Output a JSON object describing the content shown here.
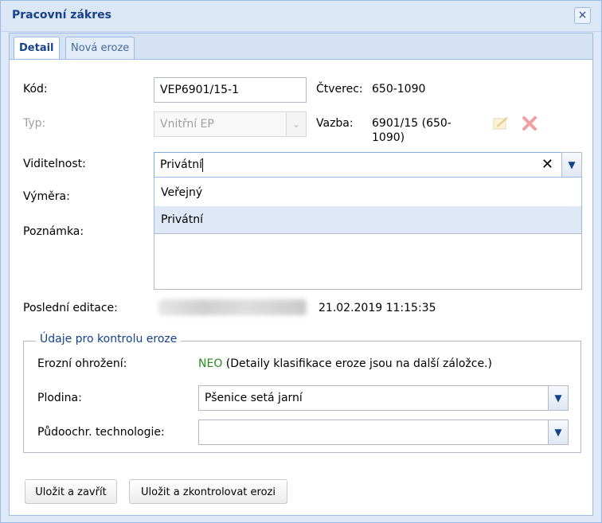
{
  "window": {
    "title": "Pracovní zákres"
  },
  "tabs": [
    {
      "label": "Detail",
      "active": true
    },
    {
      "label": "Nová eroze",
      "active": false
    }
  ],
  "form": {
    "kod": {
      "label": "Kód:",
      "value": "VEP6901/15-1"
    },
    "ctverec": {
      "label": "Čtverec:",
      "value": "650-1090"
    },
    "typ": {
      "label": "Typ:",
      "value": "Vnitřní EP"
    },
    "vazba": {
      "label": "Vazba:",
      "value_line1": "6901/15 (650-",
      "value_line2": "1090)"
    },
    "viditelnost": {
      "label": "Viditelnost:",
      "value": "Privátní",
      "options": [
        "Veřejný",
        "Privátní"
      ]
    },
    "vymera": {
      "label": "Výměra:"
    },
    "poznamka": {
      "label": "Poznámka:"
    },
    "posledni_editace": {
      "label": "Poslední editace:",
      "value": "21.02.2019 11:15:35"
    }
  },
  "eroze": {
    "legend": "Údaje pro kontrolu eroze",
    "ohrozeni_label": "Erozní ohrožení:",
    "ohrozeni_value": "NEO",
    "ohrozeni_note": "(Detaily klasifikace eroze jsou na další záložce.)",
    "plodina_label": "Plodina:",
    "plodina_value": "Pšenice setá jarní",
    "technologie_label": "Půdoochr. technologie:",
    "technologie_value": ""
  },
  "buttons": {
    "save_close": "Uložit a zavřít",
    "save_check": "Uložit a zkontrolovat erozi"
  },
  "icons": {
    "close": "×",
    "clear": "✕",
    "dropdown": "▼"
  },
  "colors": {
    "title": "#15428b",
    "neo": "#2a8a1f",
    "delete_icon": "#e88a8a"
  }
}
